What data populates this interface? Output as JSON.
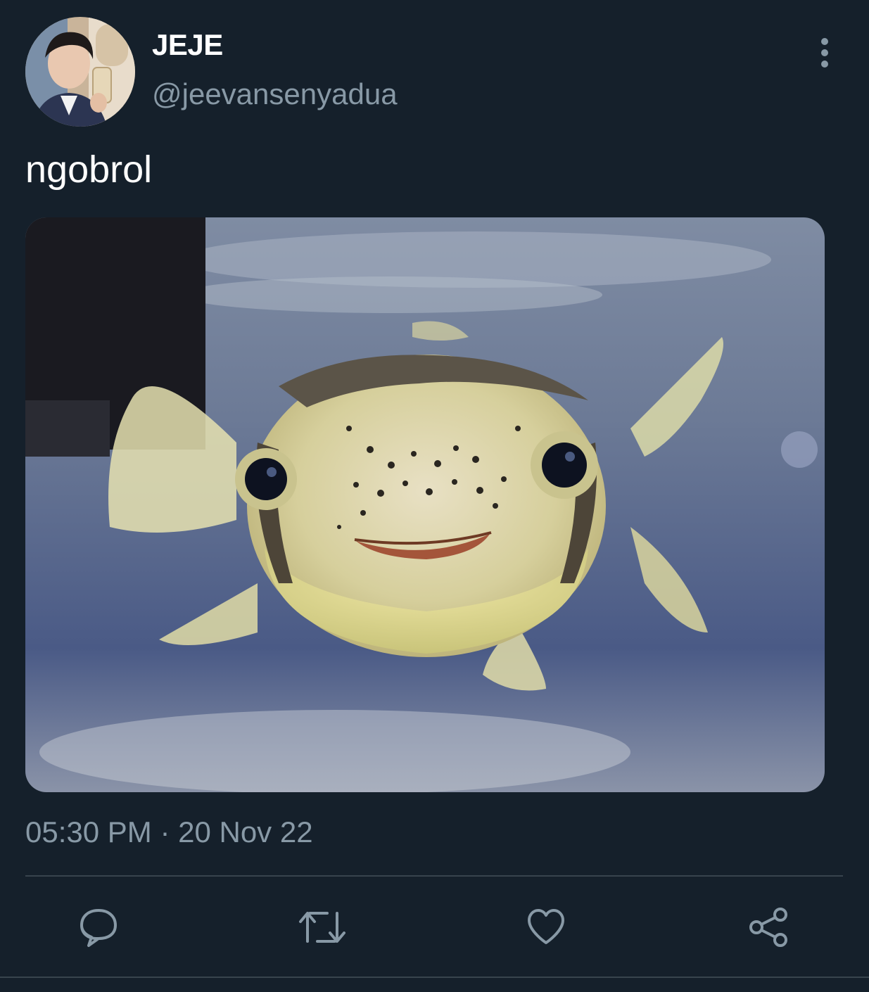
{
  "tweet": {
    "display_name": "JEJE",
    "handle": "@jeevansenyadua",
    "text": "ngobrol",
    "timestamp": "05:30 PM · 20 Nov 22"
  },
  "actions": {
    "reply_icon": "speech-bubble-icon",
    "retweet_icon": "retweet-arrows-icon",
    "like_icon": "heart-icon",
    "share_icon": "share-nodes-icon",
    "more_icon": "vertical-ellipsis-icon"
  },
  "colors": {
    "background": "#15202b",
    "text_primary": "#ffffff",
    "text_secondary": "#8899a6",
    "divider": "#38444d",
    "icon": "#8899a6"
  }
}
